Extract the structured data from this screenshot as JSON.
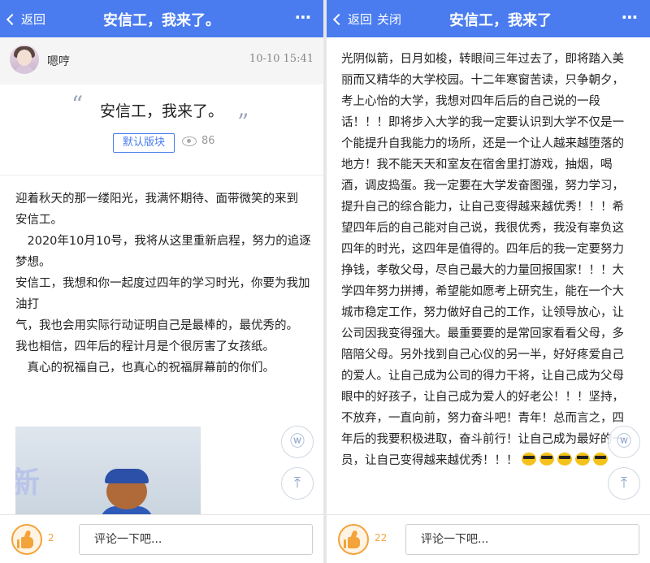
{
  "left": {
    "header": {
      "back_label": "返回",
      "title": "安信工，我来了。",
      "more_icon": "⋯"
    },
    "author": {
      "name": "嗯哼",
      "time": "10-10 15:41"
    },
    "post": {
      "title": "安信工，我来了。",
      "quote_open": "“",
      "quote_close": "”",
      "board_tag": "默认版块",
      "views": "86",
      "paragraphs": [
        "迎着秋天的那一缕阳光，我满怀期待、面带微笑的来到",
        "安信工。",
        "　2020年10月10号，我将从这里重新启程，努力的追逐梦想。",
        "安信工，我想和你一起度过四年的学习时光，你要为我加油打",
        "气，我也会用实际行动证明自己是最棒的，最优秀的。",
        "我也相信，四年后的程计月是个很厉害了女孩纸。",
        "　真心的祝福自己，也真心的祝福屏幕前的你们。"
      ]
    },
    "bottom": {
      "like_count": "2",
      "comment_placeholder": "评论一下吧..."
    }
  },
  "right": {
    "header": {
      "back_label": "返回",
      "close_label": "关闭",
      "title": "安信工，我来了",
      "more_icon": "⋯"
    },
    "body_text": "光阴似箭，日月如梭，转眼间三年过去了，即将踏入美丽而又精华的大学校园。十二年寒窗苦读，只争朝夕，考上心怡的大学，我想对四年后后的自己说的一段话！！！即将步入大学的我一定要认识到大学不仅是一个能提升自我能力的场所，还是一个让人越来越堕落的地方！我不能天天和室友在宿舍里打游戏，抽烟，喝酒，调皮捣蛋。我一定要在大学发奋图强，努力学习，提升自己的综合能力，让自己变得越来越优秀！！！希望四年后的自己能对自己说，我很优秀，我没有辜负这四年的时光，这四年是值得的。四年后的我一定要努力挣钱，孝敬父母，尽自己最大的力量回报国家！！！大学四年努力拼搏，希望能如愿考上研究生，能在一个大城市稳定工作，努力做好自己的工作，让领导放心，让公司因我变得强大。最重要要的是常回家看看父母，多陪陪父母。另外找到自己心仪的另一半，好好疼爱自己的爱人。让自己成为公司的得力干将，让自己成为父母眼中的好孩子，让自己成为爱人的好老公！！！坚持，不放弃，一直向前，努力奋斗吧！青年！总而言之，四年后的我要积极进取，奋斗前行！让自己成为最好的一员，让自己变得越来越优秀！！！",
    "bottom": {
      "like_count": "22",
      "comment_placeholder": "评论一下吧..."
    }
  },
  "colors": {
    "accent": "#4a7cf0",
    "like": "#f2a33a"
  },
  "icons": {
    "wechat": "wechat-icon",
    "top": "back-to-top-icon",
    "like": "thumbs-up-icon",
    "view": "eye-icon"
  }
}
